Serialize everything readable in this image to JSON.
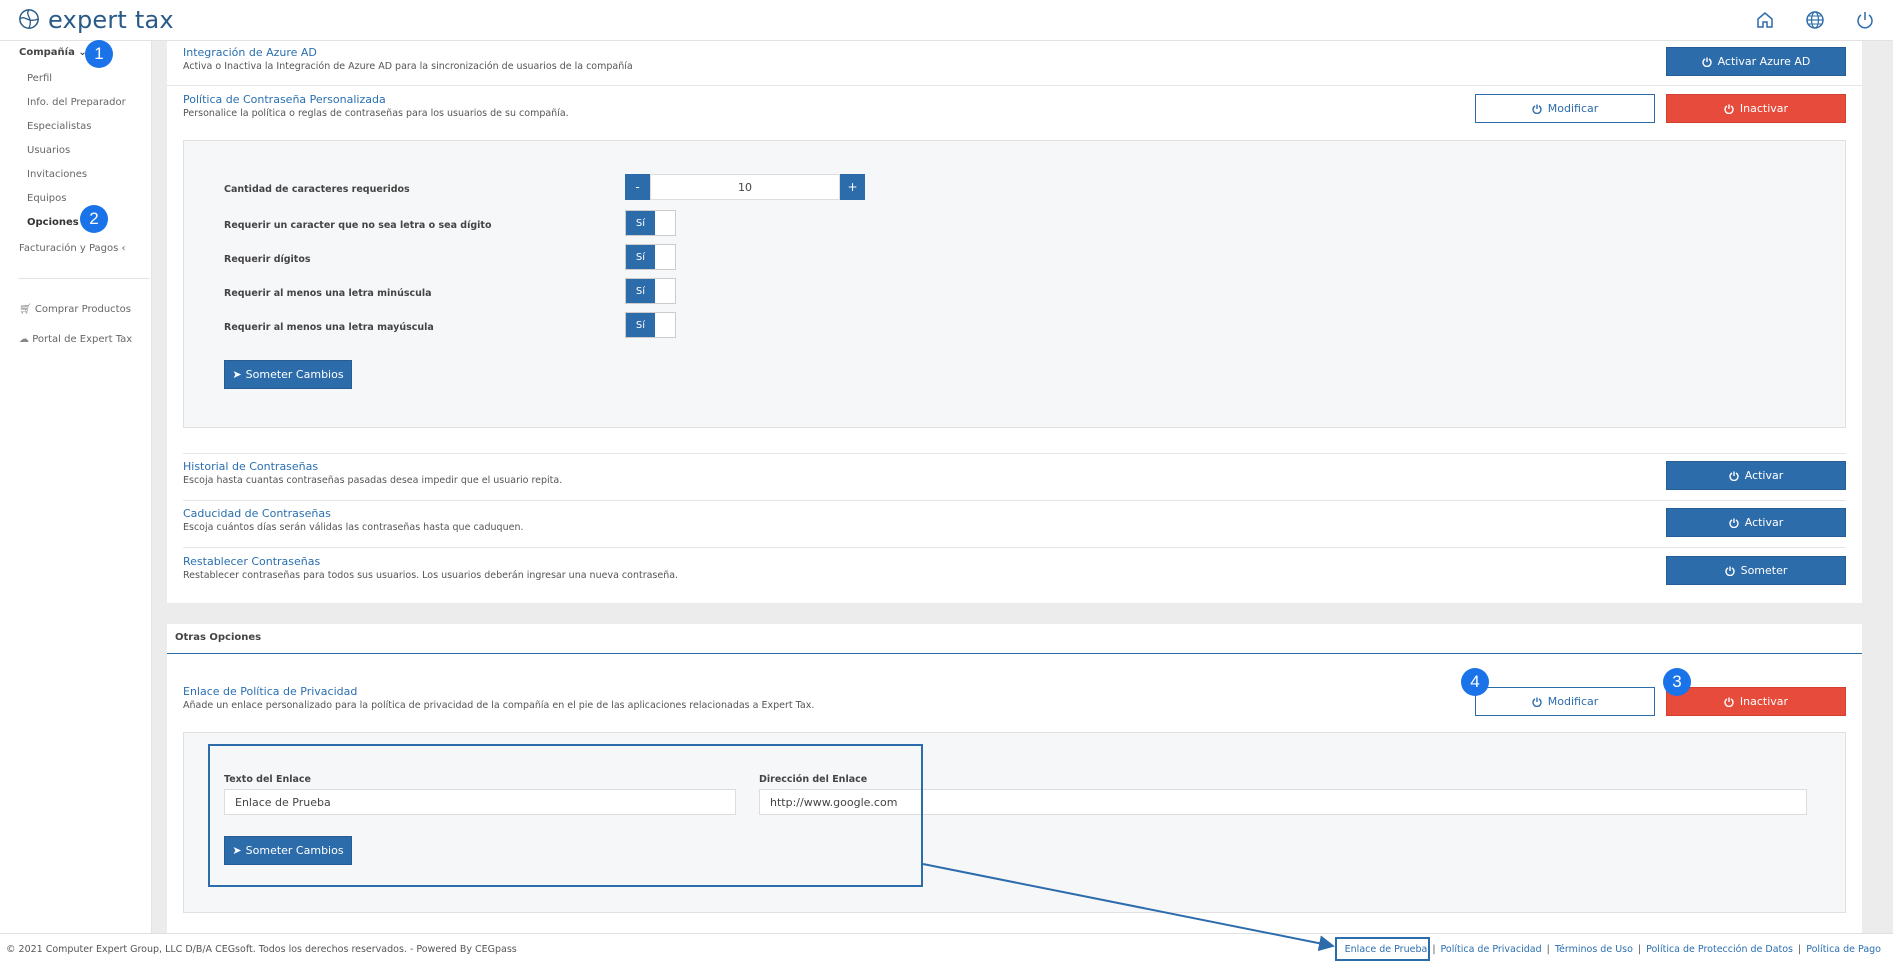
{
  "header": {
    "app_name": "expert tax",
    "icons": [
      "home-icon",
      "globe-icon",
      "power-icon"
    ]
  },
  "sidebar": {
    "company": "Compañía",
    "items": [
      "Perfil",
      "Info. del Preparador",
      "Especialistas",
      "Usuarios",
      "Invitaciones",
      "Equipos",
      "Opciones"
    ],
    "billing": "Facturación y Pagos",
    "buy_products": "Comprar Productos",
    "portal": "Portal de Expert Tax"
  },
  "badges": [
    "1",
    "2",
    "3",
    "4"
  ],
  "security": {
    "azure": {
      "title": "Integración de Azure AD",
      "desc": "Activa o Inactiva la Integración de Azure AD para la sincronización de usuarios de la compañía",
      "button": "Activar Azure AD"
    },
    "password_policy": {
      "title": "Política de Contraseña Personalizada",
      "desc": "Personalice la política o reglas de contraseñas para los usuarios de su compañía.",
      "modify": "Modificar",
      "deactivate": "Inactivar",
      "char_count_label": "Cantidad de caracteres requeridos",
      "char_count_value": "10",
      "minus": "-",
      "plus": "+",
      "rules": [
        "Requerir un caracter que no sea letra o sea dígito",
        "Requerir dígitos",
        "Requerir al menos una letra minúscula",
        "Requerir al menos una letra mayúscula"
      ],
      "toggle_label": "Sí",
      "submit": "Someter Cambios"
    },
    "history": {
      "title": "Historial de Contraseñas",
      "desc": "Escoja hasta cuantas contraseñas pasadas desea impedir que el usuario repita.",
      "button": "Activar"
    },
    "expiry": {
      "title": "Caducidad de Contraseñas",
      "desc": "Escoja cuántos días serán válidas las contraseñas hasta que caduquen.",
      "button": "Activar"
    },
    "reset": {
      "title": "Restablecer Contraseñas",
      "desc": "Restablecer contraseñas para todos sus usuarios. Los usuarios deberán ingresar una nueva contraseña.",
      "button": "Someter"
    }
  },
  "other_options": {
    "section_title": "Otras Opciones",
    "privacy": {
      "title": "Enlace de Política de Privacidad",
      "desc": "Añade un enlace personalizado para la política de privacidad de la compañía en el pie de las aplicaciones relacionadas a Expert Tax.",
      "modify": "Modificar",
      "deactivate": "Inactivar",
      "link_text_label": "Texto del Enlace",
      "link_text_value": "Enlace de Prueba",
      "link_url_label": "Dirección del Enlace",
      "link_url_value": "http://www.google.com",
      "submit": "Someter Cambios"
    }
  },
  "footer": {
    "copyright": "© 2021 Computer Expert Group, LLC D/B/A CEGsoft. Todos los derechos reservados. - Powered By CEGpass",
    "links": [
      "Enlace de Prueba",
      "Política de Privacidad",
      "Términos de Uso",
      "Política de Protección de Datos",
      "Política de Pago"
    ],
    "separator": "|"
  },
  "colors": {
    "primary": "#2d6cab",
    "danger": "#e64b3c",
    "link": "#2a6fb0",
    "badge": "#1a73e8"
  }
}
